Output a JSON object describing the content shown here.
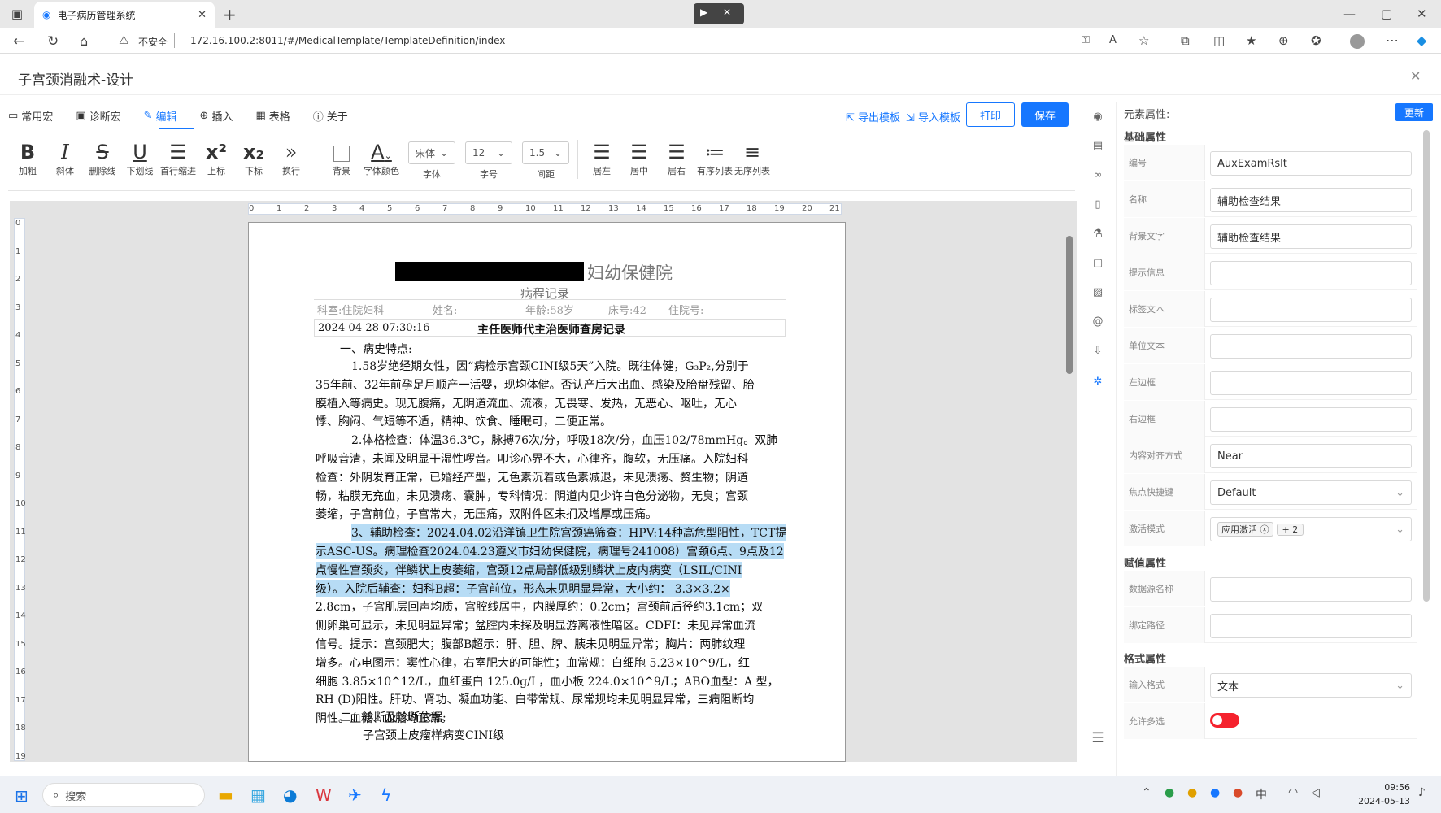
{
  "browser": {
    "tab_title": "电子病历管理系统",
    "insecure_label": "不安全",
    "url": "172.16.100.2:8011/#/MedicalTemplate/TemplateDefinition/index"
  },
  "page": {
    "title": "子宫颈消融术-设计"
  },
  "menu_tabs": [
    {
      "label": "常用宏",
      "icon": "folder-icon"
    },
    {
      "label": "诊断宏",
      "icon": "archive-icon"
    },
    {
      "label": "编辑",
      "icon": "edit-icon"
    },
    {
      "label": "插入",
      "icon": "plus-circle-icon"
    },
    {
      "label": "表格",
      "icon": "table-icon"
    },
    {
      "label": "关于",
      "icon": "info-icon"
    }
  ],
  "actions": {
    "export_template": "导出模板",
    "import_template": "导入模板",
    "print": "打印",
    "save": "保存"
  },
  "format_toolbar": {
    "bold": "加粗",
    "italic": "斜体",
    "strikethrough": "删除线",
    "underline": "下划线",
    "indent": "首行缩进",
    "superscript": "上标",
    "subscript": "下标",
    "newline": "换行",
    "background": "背景",
    "font_color": "字体颜色",
    "font_select": "宋体",
    "font_label": "字体",
    "size_select": "12",
    "size_label": "字号",
    "spacing_select": "1.5",
    "spacing_label": "间距",
    "align_left": "居左",
    "align_center": "居中",
    "align_right": "居右",
    "ordered_list": "有序列表",
    "unordered_list": "无序列表"
  },
  "ruler": {
    "h_ticks": [
      "0",
      "1",
      "2",
      "3",
      "4",
      "5",
      "6",
      "7",
      "8",
      "9",
      "10",
      "11",
      "12",
      "13",
      "14",
      "15",
      "16",
      "17",
      "18",
      "19",
      "20",
      "21"
    ],
    "v_ticks": [
      "0",
      "1",
      "2",
      "3",
      "4",
      "5",
      "6",
      "7",
      "8",
      "9",
      "10",
      "11",
      "12",
      "13",
      "14",
      "15",
      "16",
      "17",
      "18",
      "19"
    ]
  },
  "document": {
    "hospital": "妇幼保健院",
    "record_type": "病程记录",
    "info": {
      "dept": "科室:住院妇科",
      "name": "姓名:",
      "age": "年龄:58岁",
      "bed": "床号:42",
      "inpatient_no": "住院号:"
    },
    "datetime": "2024-04-28 07:30:16",
    "record_title": "主任医师代主治医师查房记录",
    "section1": "一、病史特点:",
    "lines": [
      "1.58岁绝经期女性，因“病检示宫颈CINI级5天”入院。既往体健，G₃P₂,分别于",
      "35年前、32年前孕足月顺产一活婴，现均体健。否认产后大出血、感染及胎盘残留、胎",
      "膜植入等病史。现无腹痛，无阴道流血、流液，无畏寒、发热，无恶心、呕吐，无心",
      "悸、胸闷、气短等不适，精神、饮食、睡眠可，二便正常。",
      "2.体格检查：体温36.3℃，脉搏76次/分，呼吸18次/分，血压102/78mmHg。双肺",
      "呼吸音清，未闻及明显干湿性啰音。叩诊心界不大，心律齐，腹软，无压痛。入院妇科",
      "检查：外阴发育正常，已婚经产型，无色素沉着或色素减退，未见溃疡、赘生物；阴道",
      "畅，粘膜无充血，未见溃疡、囊肿，专科情况：阴道内见少许白色分泌物，无臭；宫颈",
      "萎缩，子宫前位，子宫常大，无压痛，双附件区未扪及增厚或压痛。",
      "3、辅助检查：2024.04.02沿洋镇卫生院宫颈癌筛查：HPV:14种高危型阳性，TCT提",
      "示ASC-US。病理检查2024.04.23遵义市妇幼保健院，病理号241008）宫颈6点、9点及12",
      "点慢性宫颈炎，伴鳞状上皮萎缩，宫颈12点局部低级别鳞状上皮内病变（LSIL/CINI",
      "级）。入院后辅查：妇科B超：子宫前位，形态未见明显异常，大小约： 3.3×3.2×",
      "2.8cm，子宫肌层回声均质，宫腔线居中，内膜厚约：0.2cm；宫颈前后径约3.1cm；双",
      "侧卵巢可显示，未见明显异常；盆腔内未探及明显游离液性暗区。CDFI：未见异常血流",
      "信号。提示：宫颈肥大；腹部B超示：肝、胆、脾、胰未见明显异常；胸片：两肺纹理",
      "增多。心电图示：窦性心律，右室肥大的可能性；血常规：白细胞 5.23×10^9/L，红",
      "细胞 3.85×10^12/L，血红蛋白 125.0g/L，血小板 224.0×10^9/L；ABO血型：A 型，",
      "RH (D)阳性。肝功、肾功、凝血功能、白带常规、尿常规均未见明显异常，三病阻断均",
      "阴性。血糖、血脂均正常。"
    ],
    "section2": "二、诊断及诊断依据:",
    "diag_line": "子宫颈上皮瘤样病变CINI级"
  },
  "side_icons": [
    "eye-icon",
    "document-icon",
    "link-icon",
    "book-icon",
    "flask-icon",
    "file-icon",
    "image-icon",
    "at-icon",
    "export-icon",
    "settings-icon",
    "menu-icon"
  ],
  "properties": {
    "header": "元素属性:",
    "update_button": "更新",
    "basic_section": "基础属性",
    "rows": [
      {
        "label": "编号",
        "value": "AuxExamRslt"
      },
      {
        "label": "名称",
        "value": "辅助检查结果"
      },
      {
        "label": "背景文字",
        "value": "辅助检查结果"
      },
      {
        "label": "提示信息",
        "value": ""
      },
      {
        "label": "标签文本",
        "value": ""
      },
      {
        "label": "单位文本",
        "value": ""
      },
      {
        "label": "左边框",
        "value": ""
      },
      {
        "label": "右边框",
        "value": ""
      },
      {
        "label": "内容对齐方式",
        "value": "Near"
      },
      {
        "label": "焦点快捷键",
        "value": "Default"
      },
      {
        "label": "激活模式",
        "value": ""
      }
    ],
    "activation_tag": "应用激活",
    "activation_more": "+ 2",
    "value_section": "赋值属性",
    "value_rows": [
      {
        "label": "数据源名称",
        "value": ""
      },
      {
        "label": "绑定路径",
        "value": ""
      }
    ],
    "format_section": "格式属性",
    "format_rows": [
      {
        "label": "输入格式",
        "value": "文本"
      },
      {
        "label": "允许多选",
        "value": ""
      }
    ]
  },
  "taskbar": {
    "search_placeholder": "搜索",
    "time": "09:56",
    "date": "2024-05-13"
  }
}
